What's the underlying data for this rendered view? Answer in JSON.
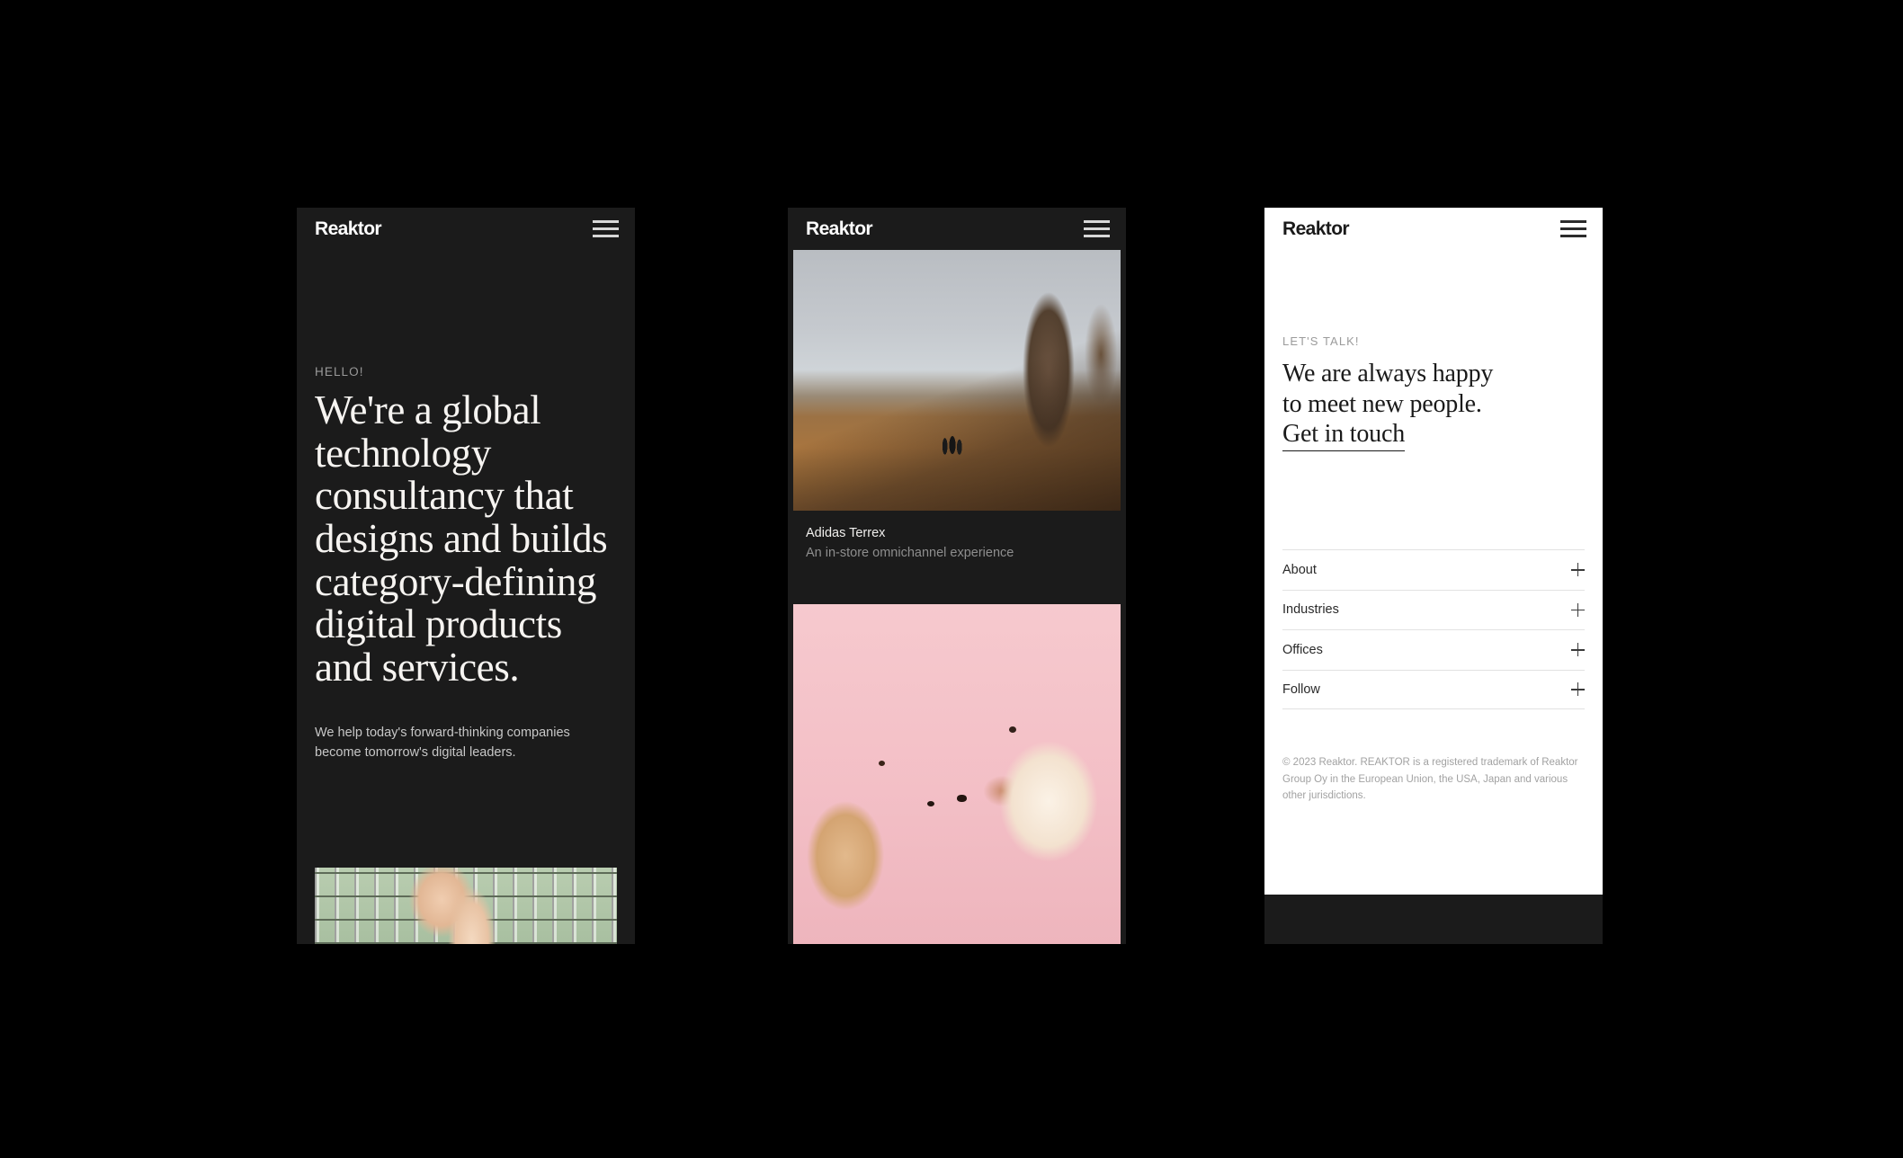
{
  "brand": {
    "name": "Reaktor",
    "accent": "#ffffff",
    "dark_bg": "#1b1b1b",
    "light_bg": "#ffffff",
    "page_bg": "#000000"
  },
  "menu": {
    "icon": "hamburger-menu-icon",
    "label": "Menu"
  },
  "screen_one": {
    "logo": "Reaktor",
    "eyebrow": "HELLO!",
    "headline": "We're a global technology consultancy that designs and builds category-defining digital products and services.",
    "subcopy": "We help today's forward-thinking companies become tomorrow's digital leaders.",
    "photo_alt": "Person's legs in front of green stadium seats"
  },
  "screen_two": {
    "logo": "Reaktor",
    "cards": [
      {
        "title": "Adidas Terrex",
        "subtitle": "An in-store omnichannel experience",
        "photo_alt": "Three hikers walking a rocky brown mountain trail below a jagged rock pinnacle"
      },
      {
        "title": "",
        "subtitle": "",
        "photo_alt": "Two dogs nose to nose on a pink background"
      }
    ]
  },
  "screen_three": {
    "logo": "Reaktor",
    "eyebrow": "LET'S TALK!",
    "headline_line_1": "We are always happy",
    "headline_line_2": "to meet new people.",
    "cta": "Get in touch",
    "accordion": [
      {
        "label": "About",
        "icon": "plus-icon"
      },
      {
        "label": "Industries",
        "icon": "plus-icon"
      },
      {
        "label": "Offices",
        "icon": "plus-icon"
      },
      {
        "label": "Follow",
        "icon": "plus-icon"
      }
    ],
    "copyright": "© 2023 Reaktor. REAKTOR is a registered trademark of Reaktor Group Oy in the European Union, the USA, Japan and various other jurisdictions."
  }
}
